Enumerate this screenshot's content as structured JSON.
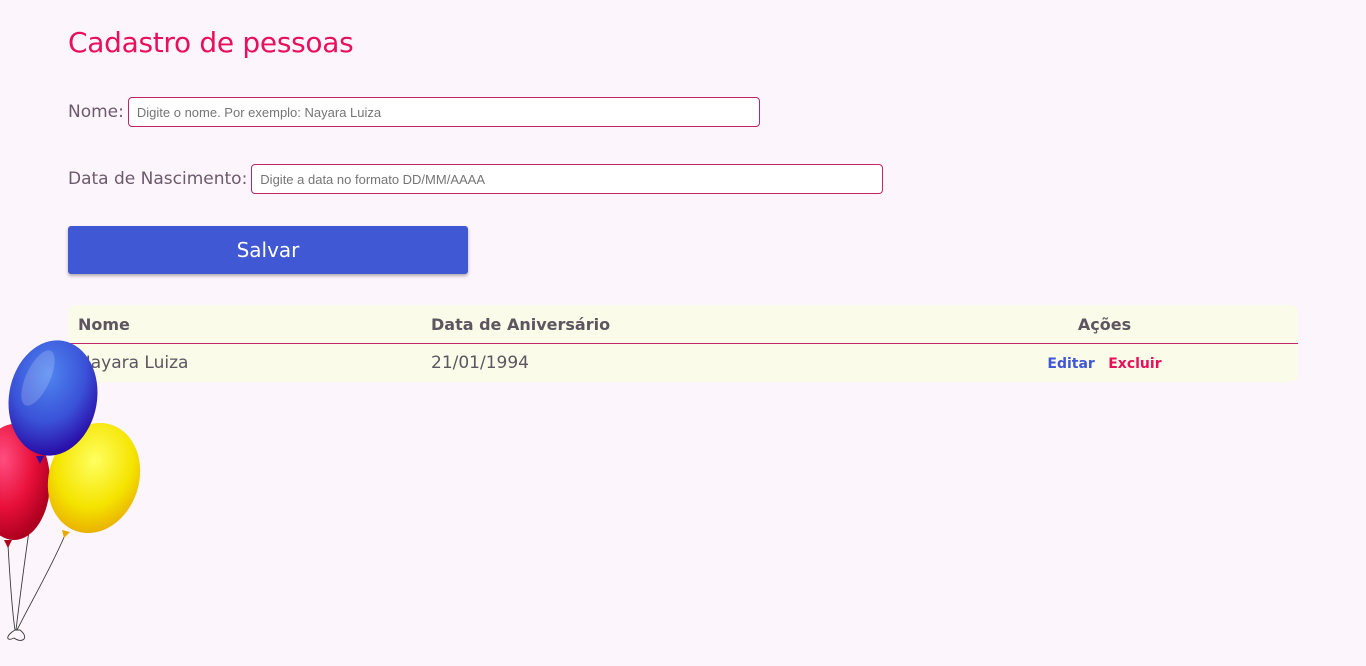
{
  "page": {
    "title": "Cadastro de pessoas"
  },
  "form": {
    "name_label": "Nome:",
    "name_placeholder": "Digite o nome. Por exemplo: Nayara Luiza",
    "name_value": "",
    "date_label": "Data de Nascimento:",
    "date_placeholder": "Digite a data no formato DD/MM/AAAA",
    "date_value": "",
    "save_label": "Salvar"
  },
  "table": {
    "headers": {
      "name": "Nome",
      "date": "Data de Aniversário",
      "actions": "Ações"
    },
    "rows": [
      {
        "name": "Nayara Luiza",
        "date": "21/01/1994",
        "edit_label": "Editar",
        "delete_label": "Excluir"
      }
    ]
  },
  "decoration": {
    "icon": "balloons-icon",
    "colors": {
      "red": "#e8103a",
      "blue": "#3a3ad0",
      "yellow": "#f5e400"
    }
  },
  "colors": {
    "accent": "#e8105a",
    "primary_button": "#4058d4",
    "background": "#fdf5fc",
    "table_background": "#fafbe8"
  }
}
